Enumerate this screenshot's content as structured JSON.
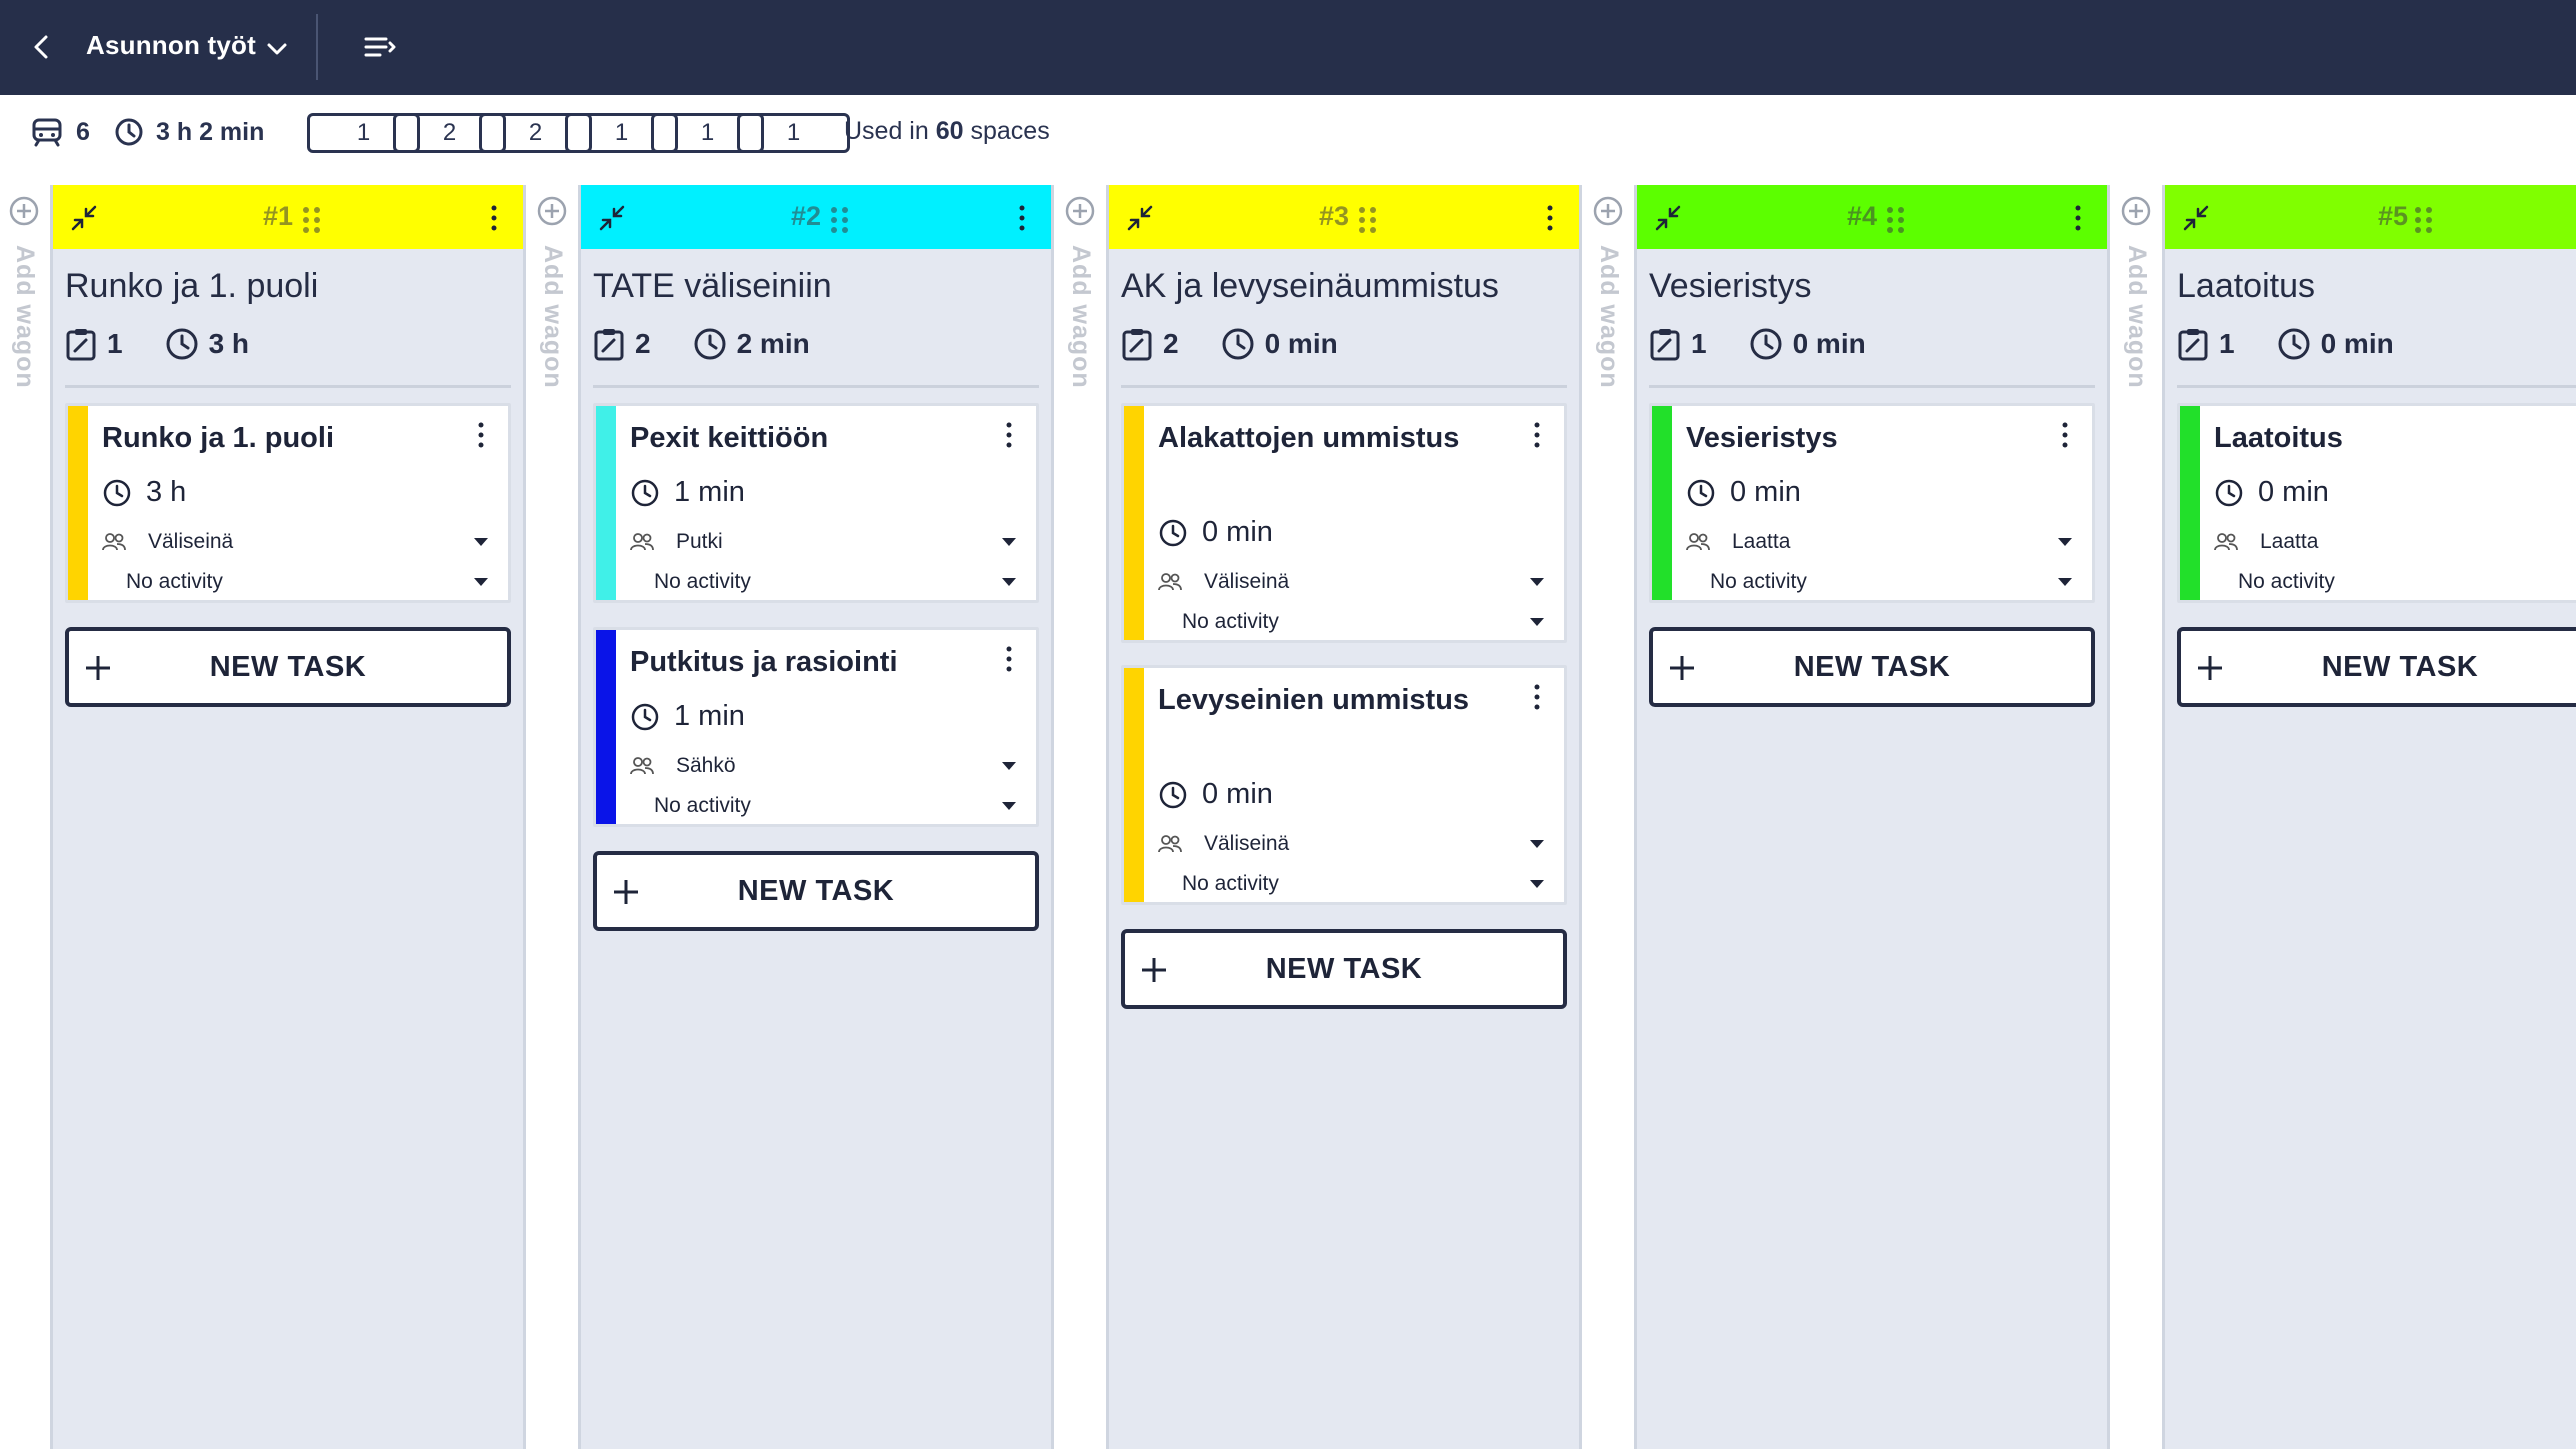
{
  "header": {
    "title": "Asunnon työt"
  },
  "stats": {
    "wagons": "6",
    "duration": "3 h 2 min",
    "boxes": [
      "1",
      "2",
      "2",
      "1",
      "1",
      "1"
    ],
    "used_prefix": "Used in",
    "used_count": "60",
    "used_suffix": "spaces"
  },
  "add_wagon_label": "Add wagon",
  "new_task_label": "NEW TASK",
  "colors": {
    "header_bg": "#262f4a",
    "wagon1": "#ffff00",
    "wagon2": "#00f0ff",
    "wagon3": "#ffff00",
    "wagon4": "#5cff00",
    "wagon5": "#80ff00"
  },
  "wagons": [
    {
      "num": "#1",
      "title": "Runko ja 1. puoli",
      "task_count": "1",
      "duration": "3 h",
      "tasks": [
        {
          "name": "Runko ja 1. puoli",
          "time": "3 h",
          "team": "Väliseinä",
          "activity": "No activity",
          "stripe": "#ffd400"
        }
      ]
    },
    {
      "num": "#2",
      "title": "TATE väliseiniin",
      "task_count": "2",
      "duration": "2 min",
      "tasks": [
        {
          "name": "Pexit keittiöön",
          "time": "1 min",
          "team": "Putki",
          "activity": "No activity",
          "stripe": "#40f0e8"
        },
        {
          "name": "Putkitus ja rasiointi",
          "time": "1 min",
          "team": "Sähkö",
          "activity": "No activity",
          "stripe": "#0a14e8"
        }
      ]
    },
    {
      "num": "#3",
      "title": "AK ja levyseinäummistus",
      "task_count": "2",
      "duration": "0 min",
      "tasks": [
        {
          "name": "Alakattojen ummistus",
          "time": "0 min",
          "team": "Väliseinä",
          "activity": "No activity",
          "stripe": "#ffd400"
        },
        {
          "name": "Levyseinien ummistus",
          "time": "0 min",
          "team": "Väliseinä",
          "activity": "No activity",
          "stripe": "#ffd400"
        }
      ]
    },
    {
      "num": "#4",
      "title": "Vesieristys",
      "task_count": "1",
      "duration": "0 min",
      "tasks": [
        {
          "name": "Vesieristys",
          "time": "0 min",
          "team": "Laatta",
          "activity": "No activity",
          "stripe": "#22e02a"
        }
      ]
    },
    {
      "num": "#5",
      "title": "Laatoitus",
      "task_count": "1",
      "duration": "0 min",
      "tasks": [
        {
          "name": "Laatoitus",
          "time": "0 min",
          "team": "Laatta",
          "activity": "No activity",
          "stripe": "#22e02a"
        }
      ]
    }
  ]
}
